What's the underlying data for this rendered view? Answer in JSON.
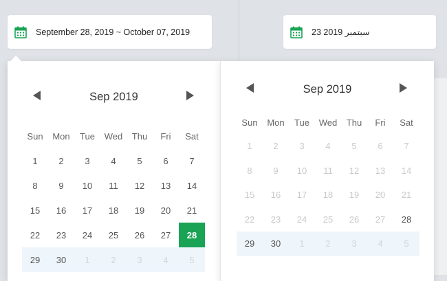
{
  "colors": {
    "accent": "#1aa354",
    "range": "#eef5fb"
  },
  "left_input": {
    "icon": "calendar-icon",
    "text": "September 28, 2019 ~ October 07, 2019"
  },
  "right_input": {
    "icon": "calendar-icon",
    "text": "23 2019 سبتمبر"
  },
  "left_calendar": {
    "month_title": "Sep 2019",
    "weekdays": [
      "Sun",
      "Mon",
      "Tue",
      "Wed",
      "Thu",
      "Fri",
      "Sat"
    ],
    "weeks": [
      [
        "1",
        "2",
        "3",
        "4",
        "5",
        "6",
        "7"
      ],
      [
        "8",
        "9",
        "10",
        "11",
        "12",
        "13",
        "14"
      ],
      [
        "15",
        "16",
        "17",
        "18",
        "19",
        "20",
        "21"
      ],
      [
        "22",
        "23",
        "24",
        "25",
        "26",
        "27",
        "28"
      ],
      [
        "29",
        "30",
        "1",
        "2",
        "3",
        "4",
        "5"
      ]
    ],
    "selected_day": "28"
  },
  "right_calendar": {
    "month_title": "Sep 2019",
    "weekdays": [
      "Sun",
      "Mon",
      "Tue",
      "Wed",
      "Thu",
      "Fri",
      "Sat"
    ],
    "weeks": [
      [
        "1",
        "2",
        "3",
        "4",
        "5",
        "6",
        "7"
      ],
      [
        "8",
        "9",
        "10",
        "11",
        "12",
        "13",
        "14"
      ],
      [
        "15",
        "16",
        "17",
        "18",
        "19",
        "20",
        "21"
      ],
      [
        "22",
        "23",
        "24",
        "25",
        "26",
        "27",
        "28"
      ],
      [
        "29",
        "30",
        "1",
        "2",
        "3",
        "4",
        "5"
      ]
    ]
  }
}
